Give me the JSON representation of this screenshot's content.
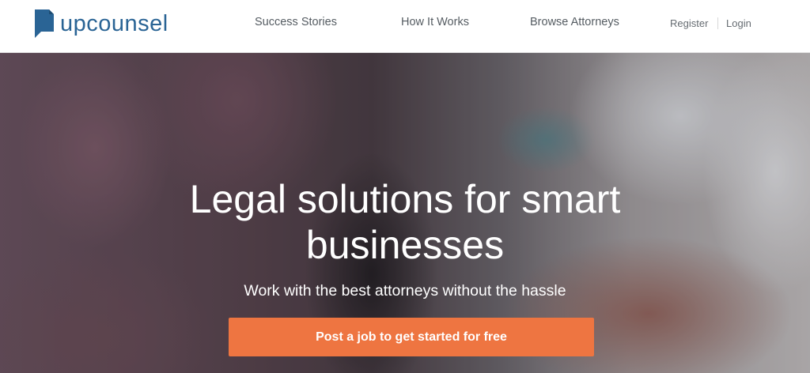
{
  "brand": {
    "name": "upcounsel",
    "logo_icon": "speech-bubble-book-icon",
    "color": "#2a6495"
  },
  "nav": {
    "items": [
      {
        "label": "Success Stories"
      },
      {
        "label": "How It Works"
      },
      {
        "label": "Browse Attorneys"
      }
    ],
    "register_label": "Register",
    "login_label": "Login"
  },
  "hero": {
    "title": "Legal solutions for smart businesses",
    "subtitle": "Work with the best attorneys without the hassle",
    "cta_label": "Post a job to get started for free",
    "cta_color": "#ee7541"
  }
}
